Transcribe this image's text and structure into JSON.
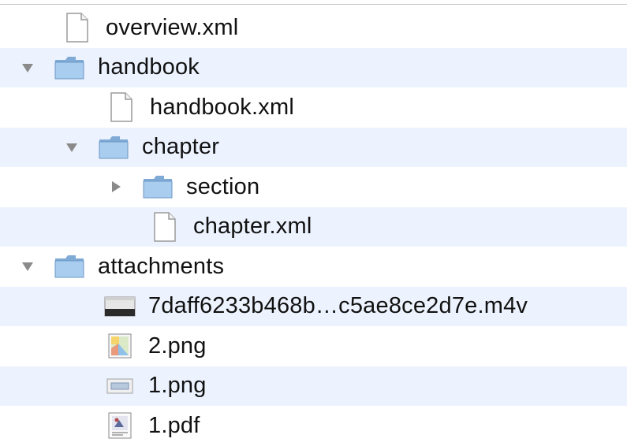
{
  "tree": {
    "items": [
      {
        "label": "overview.xml",
        "icon": "document-icon"
      },
      {
        "label": "handbook",
        "icon": "folder-icon",
        "expanded": true
      },
      {
        "label": "handbook.xml",
        "icon": "document-icon"
      },
      {
        "label": "chapter",
        "icon": "folder-icon",
        "expanded": true
      },
      {
        "label": "section",
        "icon": "folder-icon",
        "expanded": false
      },
      {
        "label": "chapter.xml",
        "icon": "document-icon"
      },
      {
        "label": "attachments",
        "icon": "folder-icon",
        "expanded": true
      },
      {
        "label": "7daff6233b468b…c5ae8ce2d7e.m4v",
        "icon": "video-file-icon"
      },
      {
        "label": "2.png",
        "icon": "image-file-icon"
      },
      {
        "label": "1.png",
        "icon": "image-file-icon"
      },
      {
        "label": "1.pdf",
        "icon": "pdf-file-icon"
      }
    ]
  },
  "colors": {
    "row_alt": "#edf3fe",
    "folder": "#8fb8e0",
    "disclosure": "#8a8a8a"
  }
}
